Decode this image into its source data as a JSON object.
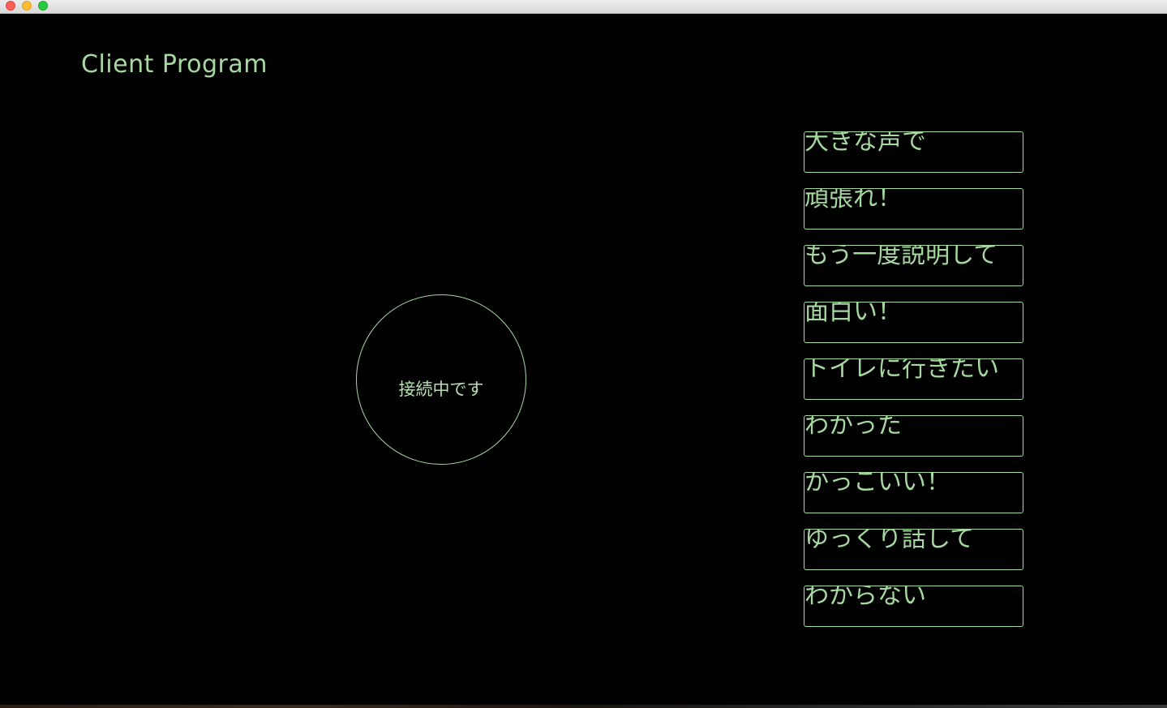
{
  "window": {
    "title": ""
  },
  "app": {
    "title": "Client Program"
  },
  "status": {
    "text": "接続中です"
  },
  "phrases": [
    {
      "label": "大きな声で"
    },
    {
      "label": "頑張れ！"
    },
    {
      "label": "もう一度説明して"
    },
    {
      "label": "面白い！"
    },
    {
      "label": "トイレに行きたい"
    },
    {
      "label": "わかった"
    },
    {
      "label": "かっこいい！"
    },
    {
      "label": "ゆっくり話して"
    },
    {
      "label": "わからない"
    }
  ],
  "colors": {
    "background": "#000000",
    "accent": "#a6d9a0"
  }
}
